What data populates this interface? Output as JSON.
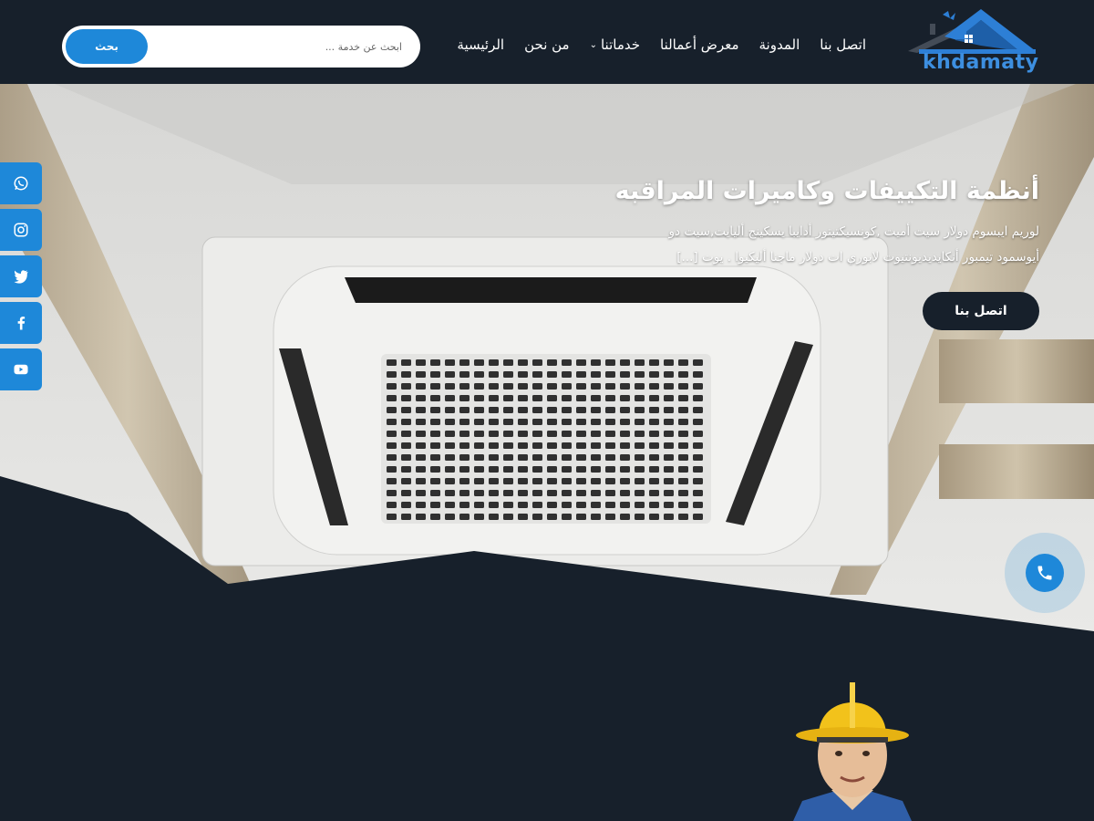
{
  "brand": {
    "logo_text": "khdamaty"
  },
  "nav": {
    "items": [
      {
        "label": "الرئيسية"
      },
      {
        "label": "من نحن"
      },
      {
        "label": "خدماتنا",
        "has_dropdown": true
      },
      {
        "label": "معرض أعمالنا"
      },
      {
        "label": "المدونة"
      },
      {
        "label": "اتصل بنا"
      }
    ]
  },
  "search": {
    "placeholder": "ابحث عن خدمة ...",
    "button_label": "بحث"
  },
  "hero": {
    "title": "أنظمة التكييفات وكاميرات المراقبه",
    "description": "لوريم ايبسوم دولار سيت أميت ,كونسيكتيتور أدايبا يسكينج أليايت,سيت دو أيوسمود تيمبور أنكايديديونتيوت لابوري ات دولار ماجنا أليكيوا . يوت [...]",
    "cta_label": "اتصل بنا"
  },
  "social": [
    "whatsapp-icon",
    "instagram-icon",
    "twitter-icon",
    "facebook-icon",
    "youtube-icon"
  ],
  "colors": {
    "dark": "#17202b",
    "accent": "#1e88d9",
    "white": "#ffffff"
  }
}
